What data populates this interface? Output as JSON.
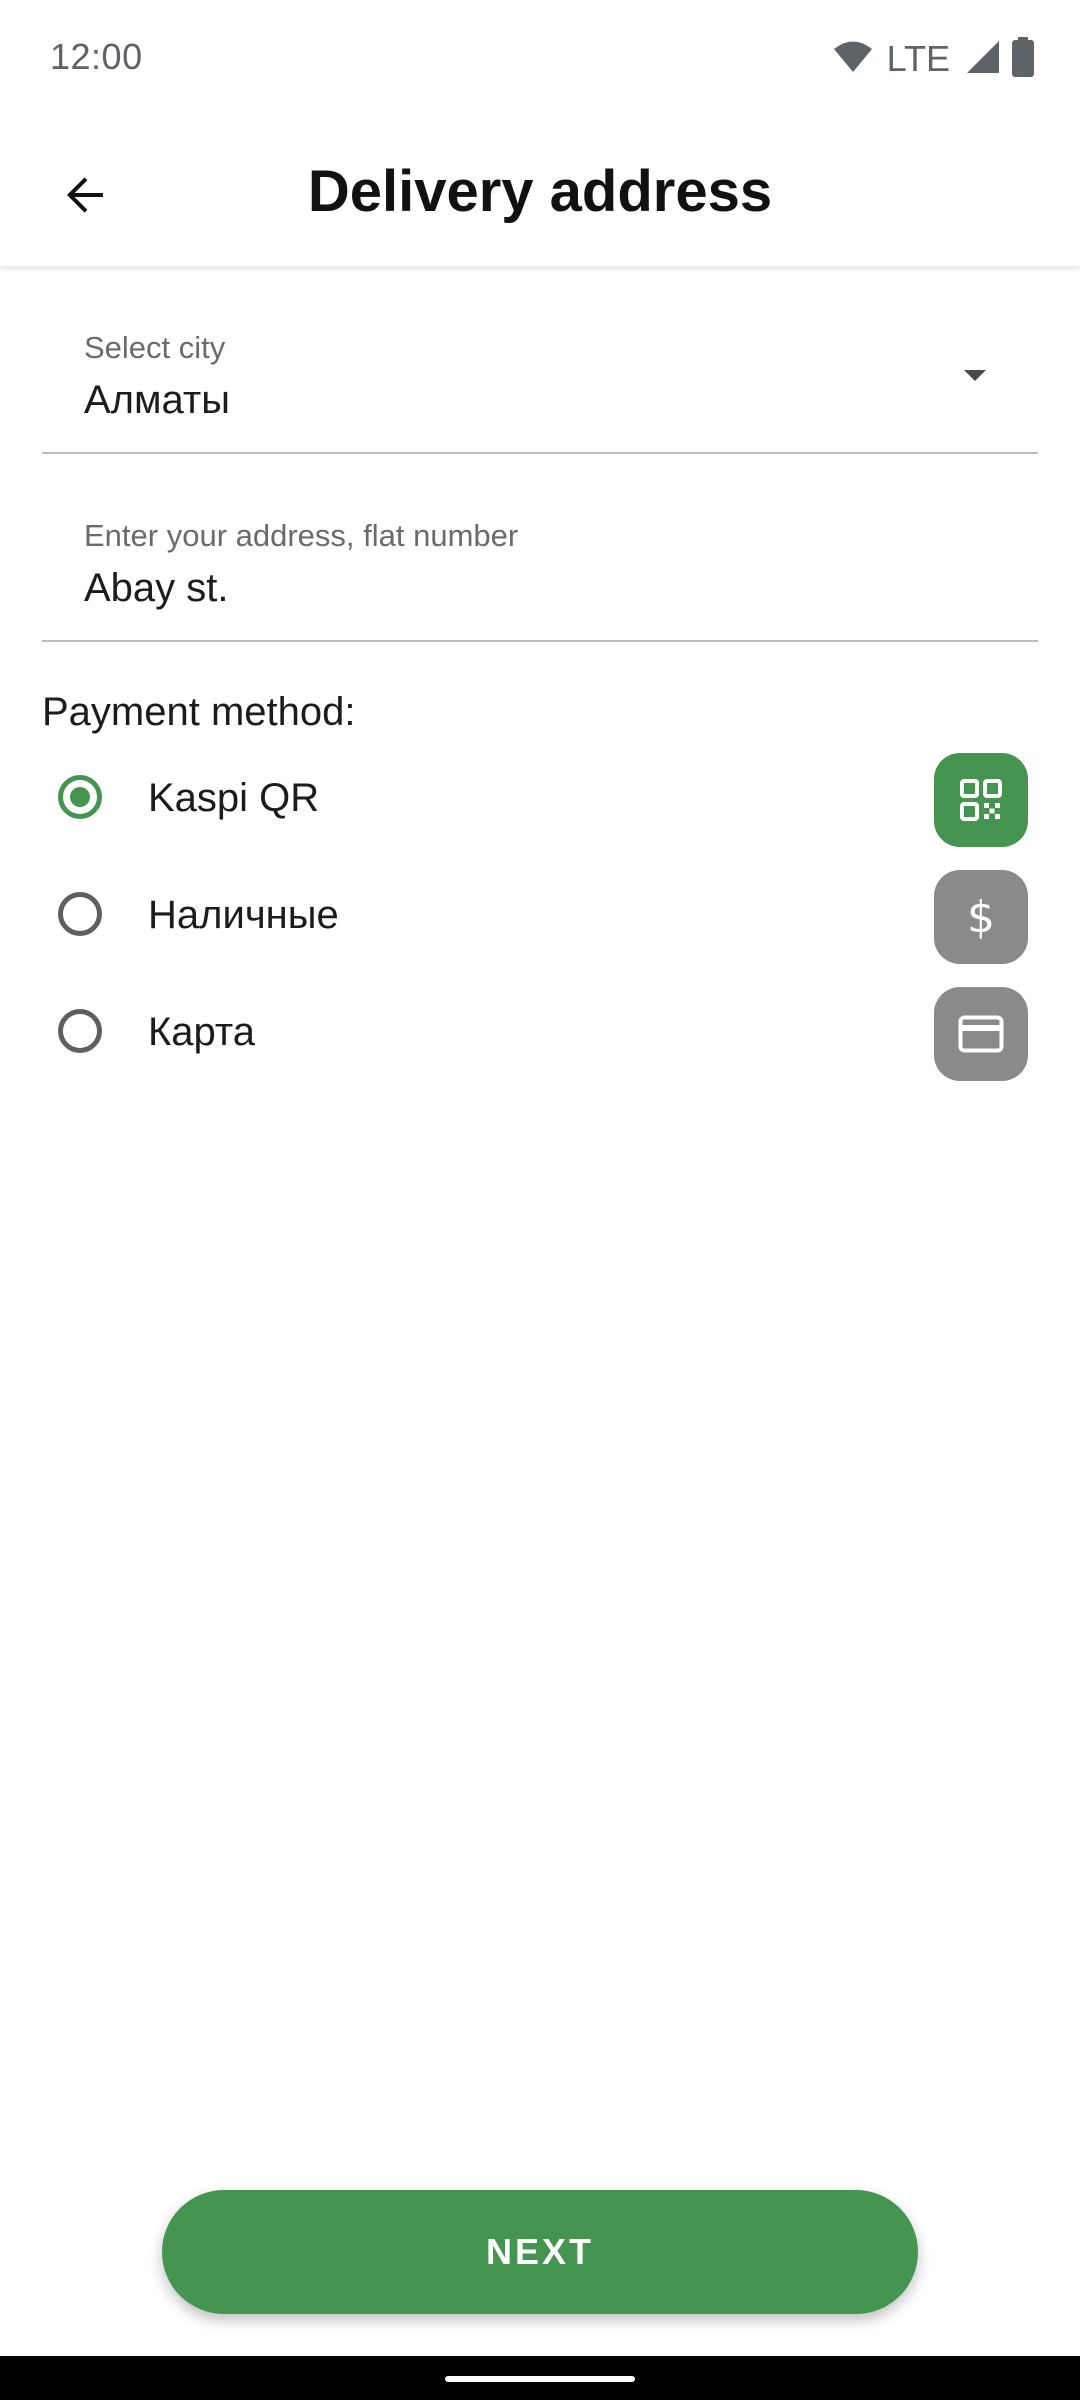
{
  "status_bar": {
    "time": "12:00",
    "network": "LTE",
    "icons": [
      "wifi-icon",
      "cell-signal-icon",
      "battery-icon"
    ]
  },
  "app_bar": {
    "title": "Delivery address",
    "back_icon": "arrow-back-icon"
  },
  "city_field": {
    "label": "Select city",
    "value": "Алматы",
    "icon": "dropdown-arrow-icon"
  },
  "address_field": {
    "label": "Enter your address, flat number",
    "value": "Abay st."
  },
  "payment": {
    "title": "Payment method:",
    "options": [
      {
        "label": "Kaspi QR",
        "selected": true,
        "icon": "qr-code-icon"
      },
      {
        "label": "Наличные",
        "selected": false,
        "icon": "dollar-icon",
        "glyph": "$"
      },
      {
        "label": "Карта",
        "selected": false,
        "icon": "credit-card-icon"
      }
    ]
  },
  "next_button": {
    "label": "NEXT"
  },
  "colors": {
    "accent": "#45944f",
    "inactive_badge": "#8a8a8a",
    "divider": "#bdbdbd"
  }
}
